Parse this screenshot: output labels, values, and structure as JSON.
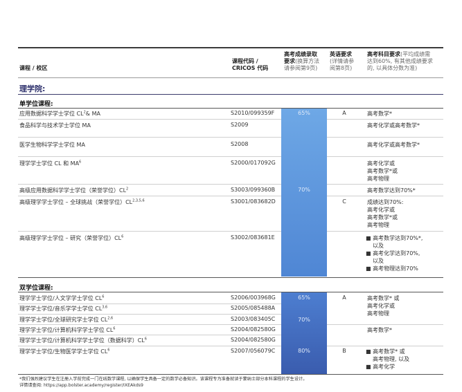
{
  "header": {
    "course_campus": "课程 / 校区",
    "code_line1": "课程代码 /",
    "code_line2": "CRICOS 代码",
    "score_line1": "高考成绩录取",
    "score_line2": "要求",
    "score_line2_light": "(换算方法",
    "score_line3": "请参阅第9页)",
    "eng_line1": "英语要求",
    "eng_line2": "(详情请参",
    "eng_line3": "阅第8页)",
    "subj_line1": "高考科目要求",
    "subj_line1_light": "(平均成绩需",
    "subj_line2": "达到60%, 有其他成绩要求",
    "subj_line3": "的, 以具体分数为准)"
  },
  "faculty": "理学院:",
  "single": {
    "title": "单学位课程:",
    "rows": [
      {
        "name": "应用数据科学学士学位 CL",
        "sup": "2",
        "tail": "& MA",
        "code": "S2010/099359F"
      },
      {
        "name": "食品科学与技术学士学位 MA",
        "sup": "",
        "tail": "",
        "code": "S2009"
      },
      {
        "name": "医学生物科学学士学位 MA",
        "sup": "",
        "tail": "",
        "code": "S2008"
      },
      {
        "name": "理学学士学位 CL 和 MA",
        "sup": "6",
        "tail": "",
        "code": "S2000/017092G"
      },
      {
        "name": "高级应用数据科学学士学位（荣誉学位）CL",
        "sup": "2",
        "tail": "",
        "code": "S3003/099360B"
      },
      {
        "name": "高级理学学士学位 – 全球挑战（荣誉学位）CL",
        "sup": "2,3,5,6",
        "tail": "",
        "code": "S3001/083682D"
      },
      {
        "name": "高级理学学士学位 – 研究（荣誉学位）CL",
        "sup": "6",
        "tail": "",
        "code": "S3002/083681E"
      }
    ],
    "scores": [
      "65%",
      "70%"
    ],
    "english": [
      "A",
      "C"
    ],
    "requirements": {
      "r1": "高考数学*",
      "r2": "高考化学或高考数学*",
      "r3": "高考化学或高考数学*",
      "r4": [
        "高考化学或",
        "高考数学*或",
        "高考物理"
      ],
      "r5": "高考数学达到70%*",
      "r6": [
        "成绩达到70%:",
        "高考化学或",
        "高考数学*或",
        "高考物理"
      ],
      "r7": [
        "高考数学达到70%*,",
        "以及",
        "高考化学达到70%,",
        "以及",
        "高考物理达到70%"
      ]
    }
  },
  "double": {
    "title": "双学位课程:",
    "rows": [
      {
        "name": "理学学士学位/人文学学士学位 CL",
        "sup": "6",
        "code": "S2006/003968G"
      },
      {
        "name": "理学学士学位/音乐学学士学位 CL",
        "sup": "3,6",
        "code": "S2005/085488A"
      },
      {
        "name": "理学学士学位/全球研究学士学位 CL",
        "sup": "2,6",
        "code": "S2003/083405C"
      },
      {
        "name": "理学学士学位/计算机科学学士学位 CL",
        "sup": "6",
        "code": "S2004/082580G"
      },
      {
        "name": "理学学士学位/计算机科学学士学位（数据科学）CL",
        "sup": "6",
        "code": "S2004/082580G"
      },
      {
        "name": "理学学士学位/生物医学学士学位 CL",
        "sup": "6",
        "code": "S2007/056079C"
      }
    ],
    "scores": [
      "65%",
      "70%",
      "80%"
    ],
    "english": [
      "A",
      "B"
    ],
    "requirements": {
      "r1": [
        "高考数学* 或",
        "高考化学或",
        "高考物理"
      ],
      "r2": "高考数学*",
      "r3": [
        "高考数学* 或",
        "高考物理, 以及",
        "高考化学"
      ]
    }
  },
  "footnote": {
    "line1": "*我们强烈建议学生在注册入学前完成一门在线数学课程, 以确保学生具备一定的数学必备知识。该课程专为准备就读于蒙纳士部分本科课程的学生设计。",
    "line2": "详情请查阅: https://app.bolster.academy/register/IXEAkds9"
  },
  "colors": {
    "band_light": "#6ea8e6",
    "band_dark": "#3a5cae",
    "faculty_title": "#2c2f6b"
  }
}
